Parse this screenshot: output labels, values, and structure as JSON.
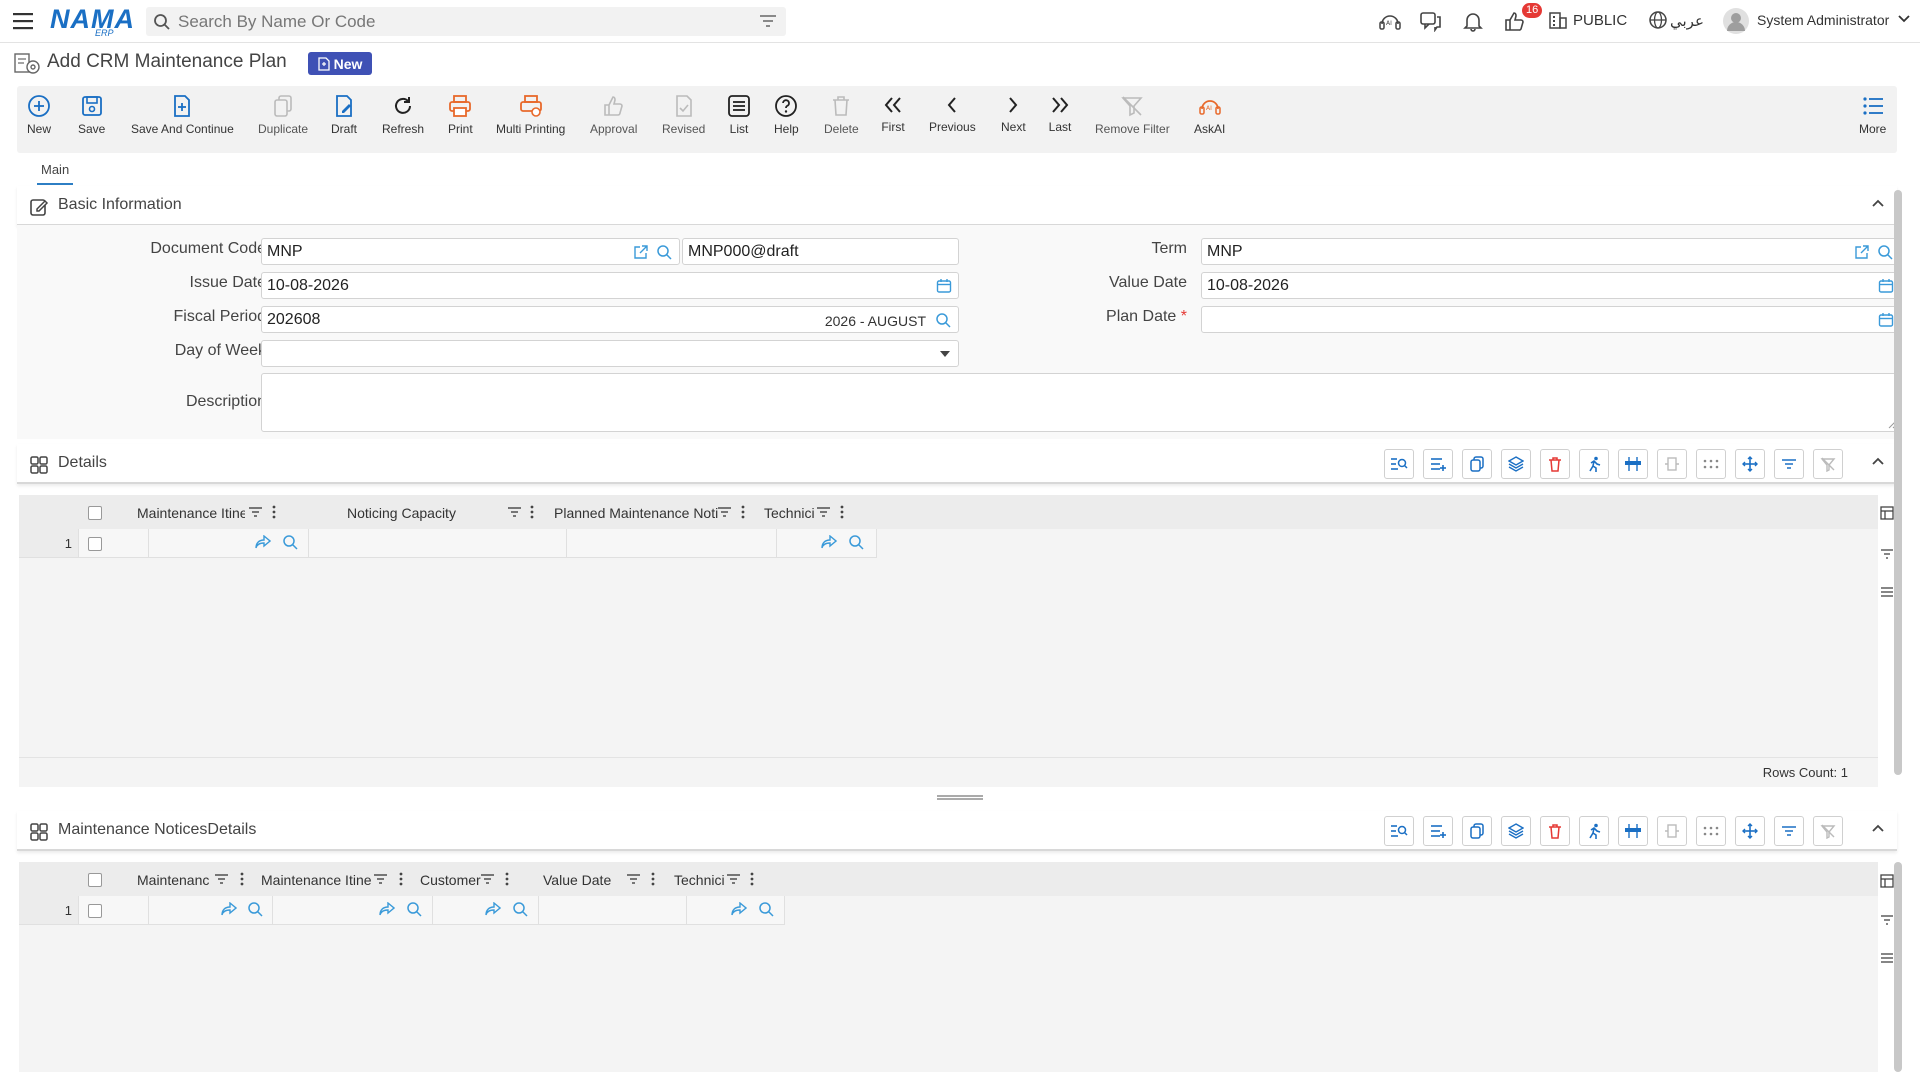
{
  "app": {
    "logo": "NAMA",
    "logo_sub": "ERP"
  },
  "search": {
    "placeholder": "Search By Name Or Code"
  },
  "topbar": {
    "notification_count": "16",
    "public_label": "PUBLIC",
    "language": "عربي",
    "user": "System Administrator"
  },
  "page": {
    "title": "Add CRM Maintenance Plan",
    "badge": "New"
  },
  "toolbar": {
    "new": "New",
    "save": "Save",
    "save_continue": "Save And Continue",
    "duplicate": "Duplicate",
    "draft": "Draft",
    "refresh": "Refresh",
    "print": "Print",
    "multi_print": "Multi Printing",
    "approval": "Approval",
    "revised": "Revised",
    "list": "List",
    "help": "Help",
    "delete": "Delete",
    "first": "First",
    "previous": "Previous",
    "next": "Next",
    "last": "Last",
    "remove_filter": "Remove Filter",
    "askai": "AskAI",
    "more": "More"
  },
  "tabs": {
    "main": "Main"
  },
  "basic": {
    "title": "Basic Information",
    "doc_code_label": "Document Code",
    "doc_code": "MNP",
    "doc_number": "MNP000@draft",
    "term_label": "Term",
    "term": "MNP",
    "issue_date_label": "Issue Date",
    "issue_date": "10-08-2026",
    "value_date_label": "Value Date",
    "value_date": "10-08-2026",
    "fiscal_label": "Fiscal Period",
    "fiscal": "202608",
    "fiscal_desc": "2026 - AUGUST",
    "plan_date_label": "Plan Date",
    "plan_date": "",
    "dow_label": "Day of Week",
    "dow": "",
    "desc_label": "Description",
    "desc": ""
  },
  "details": {
    "title": "Details",
    "columns": [
      "Maintenance Itine",
      "Noticing Capacity",
      "Planned Maintenance Noti",
      "Technici"
    ],
    "row_num": "1",
    "rows_count": "Rows Count: 1"
  },
  "notices": {
    "title": "Maintenance NoticesDetails",
    "columns": [
      "Maintenance",
      "Maintenance Itine",
      "Customer",
      "Value Date",
      "Technici"
    ],
    "row_num": "1"
  },
  "colors": {
    "accent": "#1a6fc4",
    "badge": "#3f51b5",
    "print": "#e8692b",
    "danger": "#e53935"
  }
}
